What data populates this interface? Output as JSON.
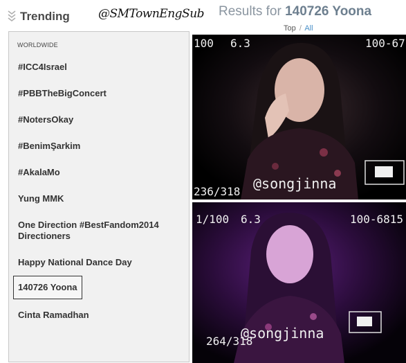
{
  "header": {
    "trending_label": "Trending",
    "watermark": "@SMTownEngSub",
    "results_prefix": "Results for",
    "results_query": "140726 Yoona",
    "filter_top": "Top",
    "filter_separator": "/",
    "filter_all": "All"
  },
  "trends": {
    "region": "WORLDWIDE",
    "items": [
      {
        "label": "#ICC4Israel"
      },
      {
        "label": "#PBBTheBigConcert"
      },
      {
        "label": "#NotersOkay"
      },
      {
        "label": "#BenimŞarkim"
      },
      {
        "label": "#AkalaMo"
      },
      {
        "label": "Yung MMK"
      },
      {
        "label": "One Direction #BestFandom2014 Directioners"
      },
      {
        "label": "Happy National Dance Day"
      },
      {
        "label": "140726 Yoona",
        "selected": true
      },
      {
        "label": "Cinta Ramadhan"
      }
    ]
  },
  "photos": [
    {
      "top_left": "100",
      "top_mid": "6.3",
      "top_right": "100-67",
      "counter": "236/318",
      "credit": "@songjinna"
    },
    {
      "top_left": "1/100",
      "top_mid": "6.3",
      "top_right": "100-6815",
      "counter": "264/318",
      "credit": "@songjinna"
    }
  ],
  "colors": {
    "accent_link": "#4a90c8",
    "panel_bg": "#f1f1f1",
    "photo_bg": "#000000"
  }
}
